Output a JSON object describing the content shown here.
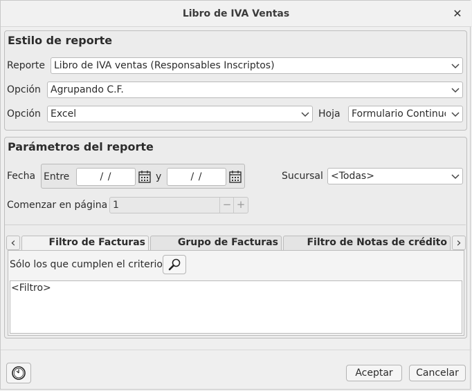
{
  "window": {
    "title": "Libro de IVA Ventas",
    "close_icon": "close-icon"
  },
  "estilo": {
    "title": "Estilo de reporte",
    "reporte_label": "Reporte",
    "reporte_value": "Libro de IVA ventas (Responsables Inscriptos)",
    "opcion1_label": "Opción",
    "opcion1_value": "Agrupando C.F.",
    "opcion2_label": "Opción",
    "opcion2_value": "Excel",
    "hoja_label": "Hoja",
    "hoja_value": "Formulario Continuo"
  },
  "parametros": {
    "title": "Parámetros del reporte",
    "fecha_label": "Fecha",
    "entre_label": "Entre",
    "desde_value": "/ /",
    "y_label": "y",
    "hasta_value": "/ /",
    "sucursal_label": "Sucursal",
    "sucursal_value": "<Todas>",
    "pagina_label": "Comenzar en página",
    "pagina_value": "1",
    "minus": "−",
    "plus": "+"
  },
  "tabs": {
    "items": [
      {
        "label": "Filtro de Facturas",
        "active": true
      },
      {
        "label": "Grupo de Facturas",
        "active": false
      },
      {
        "label": "Filtro de Notas de crédito",
        "active": false
      }
    ],
    "prev": "‹",
    "next": "›"
  },
  "filtro": {
    "criterio_label": "Sólo los que cumplen el criterio",
    "filtro_text": "<Filtro>"
  },
  "footer": {
    "aceptar": "Aceptar",
    "cancelar": "Cancelar"
  }
}
